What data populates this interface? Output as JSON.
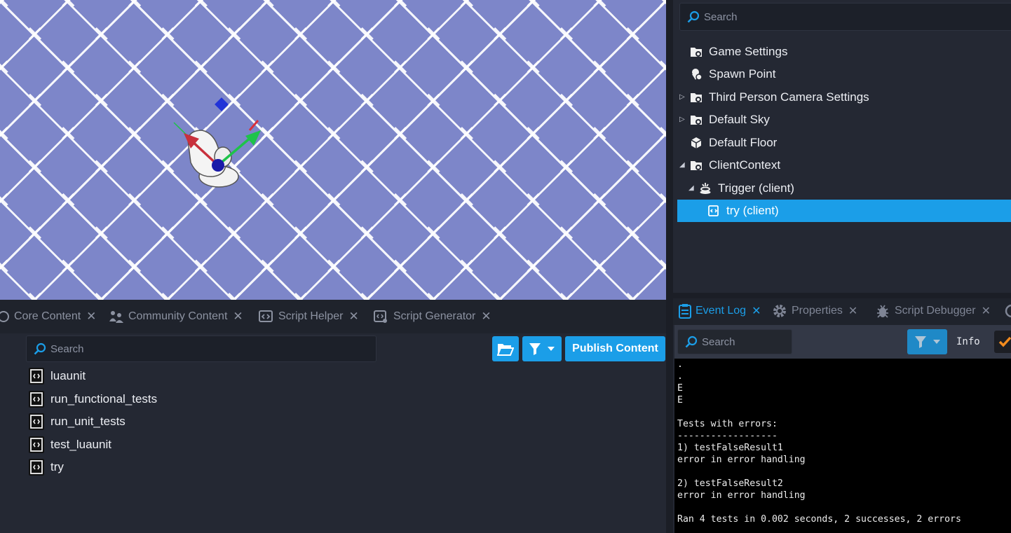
{
  "hierarchy": {
    "search_placeholder": "Search",
    "items": [
      {
        "label": "Game Settings",
        "icon": "settings-folder-icon"
      },
      {
        "label": "Spawn Point",
        "icon": "spawn-point-icon"
      },
      {
        "label": "Third Person Camera Settings",
        "icon": "settings-folder-icon",
        "expandable": true
      },
      {
        "label": "Default Sky",
        "icon": "settings-folder-icon",
        "expandable": true
      },
      {
        "label": "Default Floor",
        "icon": "cube-icon"
      },
      {
        "label": "ClientContext",
        "icon": "settings-folder-icon",
        "expanded": true
      },
      {
        "label": "Trigger (client)",
        "icon": "trigger-icon",
        "expanded": true
      },
      {
        "label": "try (client)",
        "icon": "script-icon",
        "selected": true
      }
    ]
  },
  "content_tabs": [
    {
      "label": "Core Content",
      "icon": "core-content-icon"
    },
    {
      "label": "Community Content",
      "icon": "community-content-icon"
    },
    {
      "label": "Script Helper",
      "icon": "script-helper-icon"
    },
    {
      "label": "Script Generator",
      "icon": "script-generator-icon"
    }
  ],
  "content": {
    "search_placeholder": "Search",
    "publish_label": "Publish Content",
    "scripts": [
      "luaunit",
      "run_functional_tests",
      "run_unit_tests",
      "test_luaunit",
      "try"
    ]
  },
  "log_tabs": [
    {
      "label": "Event Log",
      "icon": "event-log-icon",
      "active": true
    },
    {
      "label": "Properties",
      "icon": "gear-icon"
    },
    {
      "label": "Script Debugger",
      "icon": "bug-icon"
    }
  ],
  "event_log": {
    "search_placeholder": "Search",
    "level": "Info",
    "lines": [
      ".",
      ".",
      "E",
      "E",
      "",
      "Tests with errors:",
      "------------------",
      "1) testFalseResult1",
      "error in error handling",
      "",
      "2) testFalseResult2",
      "error in error handling",
      "",
      "Ran 4 tests in 0.002 seconds, 2 successes, 2 errors"
    ]
  },
  "colors": {
    "accent": "#1b9ee8",
    "panel_bg": "#242833",
    "floor": "#7d86c9",
    "gizmo_x": "#c8303c",
    "gizmo_y": "#1ec34a",
    "gizmo_z": "#2133d8"
  }
}
